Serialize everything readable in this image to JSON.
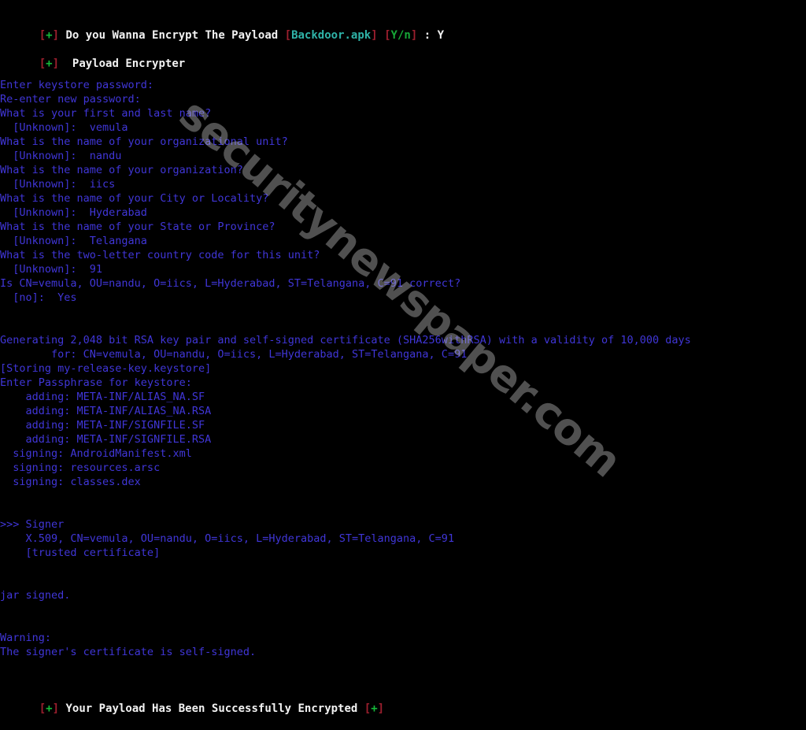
{
  "terminal": {
    "background_color": "#000000",
    "body_text_color": "#4036d8",
    "bold_white_color": "#f2f2f2",
    "bracket_red_color": "#9c1f2e",
    "plus_green_color": "#15bb3a",
    "filename_cyan_color": "#2fb3a8",
    "watermark": "securitynewspaper.com"
  },
  "prompt_line": {
    "open_bracket": "[",
    "plus": "+",
    "close_bracket": "]",
    "question": "Do you Wanna Encrypt The Payload",
    "file_open_bracket": "[",
    "file_name": "Backdoor.apk",
    "file_close_bracket": "]",
    "choice_open_bracket": "[",
    "choice": "Y/n",
    "choice_close_bracket": "]",
    "separator": ":",
    "answer": "Y"
  },
  "banner": {
    "open_bracket": "[",
    "plus": "+",
    "close_bracket": "]",
    "title": "Payload Encrypter"
  },
  "keytool": {
    "lines": [
      "Enter keystore password:",
      "Re-enter new password:",
      "What is your first and last name?",
      "  [Unknown]:  vemula",
      "What is the name of your organizational unit?",
      "  [Unknown]:  nandu",
      "What is the name of your organization?",
      "  [Unknown]:  iics",
      "What is the name of your City or Locality?",
      "  [Unknown]:  Hyderabad",
      "What is the name of your State or Province?",
      "  [Unknown]:  Telangana",
      "What is the two-letter country code for this unit?",
      "  [Unknown]:  91",
      "Is CN=vemula, OU=nandu, O=iics, L=Hyderabad, ST=Telangana, C=91 correct?",
      "  [no]:  Yes"
    ]
  },
  "generating": {
    "lines": [
      "Generating 2,048 bit RSA key pair and self-signed certificate (SHA256withRSA) with a validity of 10,000 days",
      "        for: CN=vemula, OU=nandu, O=iics, L=Hyderabad, ST=Telangana, C=91",
      "[Storing my-release-key.keystore]",
      "Enter Passphrase for keystore:"
    ]
  },
  "jarsigner": {
    "lines": [
      "    adding: META-INF/ALIAS_NA.SF",
      "    adding: META-INF/ALIAS_NA.RSA",
      "    adding: META-INF/SIGNFILE.SF",
      "    adding: META-INF/SIGNFILE.RSA",
      "  signing: AndroidManifest.xml",
      "  signing: resources.arsc",
      "  signing: classes.dex"
    ]
  },
  "signer": {
    "lines": [
      ">>> Signer",
      "    X.509, CN=vemula, OU=nandu, O=iics, L=Hyderabad, ST=Telangana, C=91",
      "    [trusted certificate]"
    ],
    "result": "jar signed."
  },
  "warning": {
    "heading": "Warning:",
    "message": "The signer's certificate is self-signed."
  },
  "success_line": {
    "open_bracket": "[",
    "plus": "+",
    "close_bracket": "]",
    "message": "Your Payload Has Been Successfully Encrypted",
    "tail_open_bracket": "[",
    "tail_plus": "+",
    "tail_close_bracket": "]"
  }
}
